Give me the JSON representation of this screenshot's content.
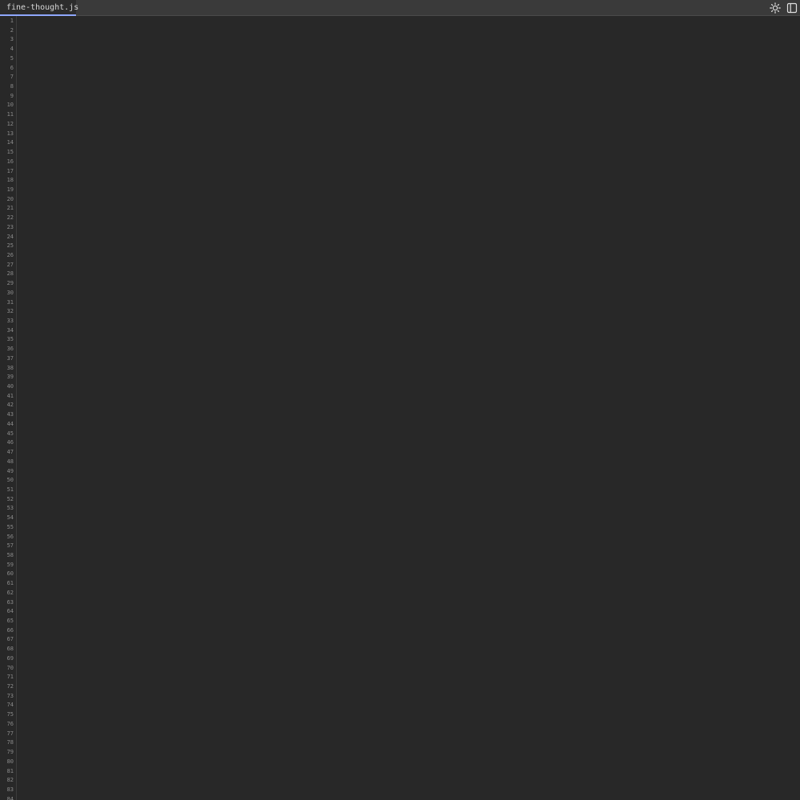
{
  "tab": {
    "filename": "fine-thought.js"
  },
  "icons": {
    "theme": "sun-icon",
    "panel": "sidebar-toggle-icon"
  },
  "colors": {
    "background": "#282828",
    "tab_accent": "#8fa8ff"
  },
  "editor": {
    "line_count": 84,
    "content": ""
  }
}
